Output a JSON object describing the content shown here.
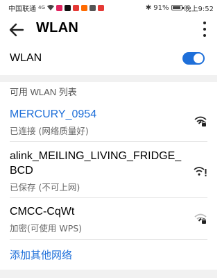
{
  "status_bar": {
    "carrier": "中国联通",
    "signal_text": "4G",
    "battery_text": "91%",
    "time_text": "晚上9:52",
    "battery_level": 0.91,
    "app_icon_colors": [
      "#e0245e",
      "#111111",
      "#e53935",
      "#ff6b00",
      "#555555",
      "#e53935"
    ]
  },
  "header": {
    "title": "WLAN"
  },
  "wlan_toggle": {
    "label": "WLAN",
    "enabled": true
  },
  "section": {
    "title": "可用 WLAN 列表"
  },
  "networks": [
    {
      "name": "MERCURY_0954",
      "status": "已连接 (网络质量好)",
      "connected": true,
      "icon": "wifi-lock-icon"
    },
    {
      "name": "alink_MEILING_LIVING_FRIDGE_BCD",
      "status": "已保存 (不可上网)",
      "connected": false,
      "icon": "wifi-warning-icon"
    },
    {
      "name": "CMCC-CqWt",
      "status": "加密(可使用 WPS)",
      "connected": false,
      "icon": "wifi-lock-icon"
    }
  ],
  "add_network": {
    "label": "添加其他网络"
  },
  "colors": {
    "accent": "#1e6fd9",
    "band": "#f1f1f1"
  }
}
